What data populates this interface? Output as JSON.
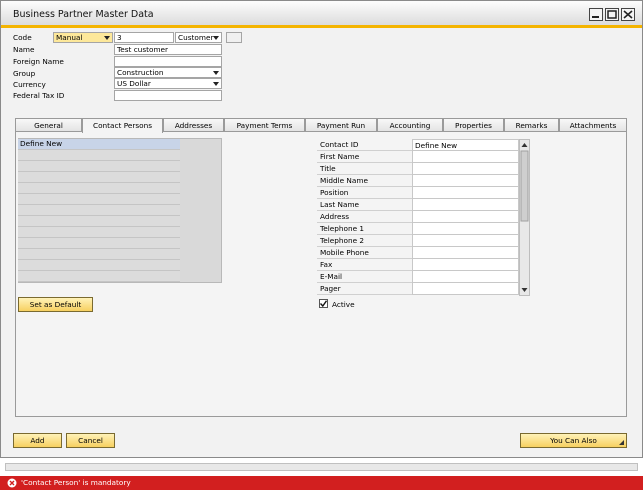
{
  "window": {
    "title": "Business Partner Master Data"
  },
  "header": {
    "code": {
      "label": "Code",
      "series": "Manual",
      "value": "3",
      "type": "Customer"
    },
    "name": {
      "label": "Name",
      "value": "Test customer"
    },
    "foreign_name": {
      "label": "Foreign Name",
      "value": ""
    },
    "group": {
      "label": "Group",
      "value": "Construction"
    },
    "currency": {
      "label": "Currency",
      "value": "US Dollar"
    },
    "federal_tax_id": {
      "label": "Federal Tax ID",
      "value": ""
    }
  },
  "tabs": [
    {
      "label": "General",
      "active": false
    },
    {
      "label": "Contact Persons",
      "active": true
    },
    {
      "label": "Addresses",
      "active": false
    },
    {
      "label": "Payment Terms",
      "active": false
    },
    {
      "label": "Payment Run",
      "active": false
    },
    {
      "label": "Accounting",
      "active": false
    },
    {
      "label": "Properties",
      "active": false
    },
    {
      "label": "Remarks",
      "active": false
    },
    {
      "label": "Attachments",
      "active": false
    }
  ],
  "contacts": {
    "list": [
      "Define New"
    ],
    "set_default_label": "Set as Default",
    "fields": [
      {
        "label": "Contact ID",
        "value": "Define New"
      },
      {
        "label": "First Name",
        "value": ""
      },
      {
        "label": "Title",
        "value": ""
      },
      {
        "label": "Middle Name",
        "value": ""
      },
      {
        "label": "Position",
        "value": ""
      },
      {
        "label": "Last Name",
        "value": ""
      },
      {
        "label": "Address",
        "value": ""
      },
      {
        "label": "Telephone 1",
        "value": ""
      },
      {
        "label": "Telephone 2",
        "value": ""
      },
      {
        "label": "Mobile Phone",
        "value": ""
      },
      {
        "label": "Fax",
        "value": ""
      },
      {
        "label": "E-Mail",
        "value": ""
      },
      {
        "label": "Pager",
        "value": ""
      }
    ],
    "active_label": "Active",
    "active_checked": true
  },
  "footer": {
    "add_label": "Add",
    "cancel_label": "Cancel",
    "you_can_also_label": "You Can Also"
  },
  "status": {
    "message": "'Contact Person' is mandatory",
    "color": "#d21f1f"
  }
}
